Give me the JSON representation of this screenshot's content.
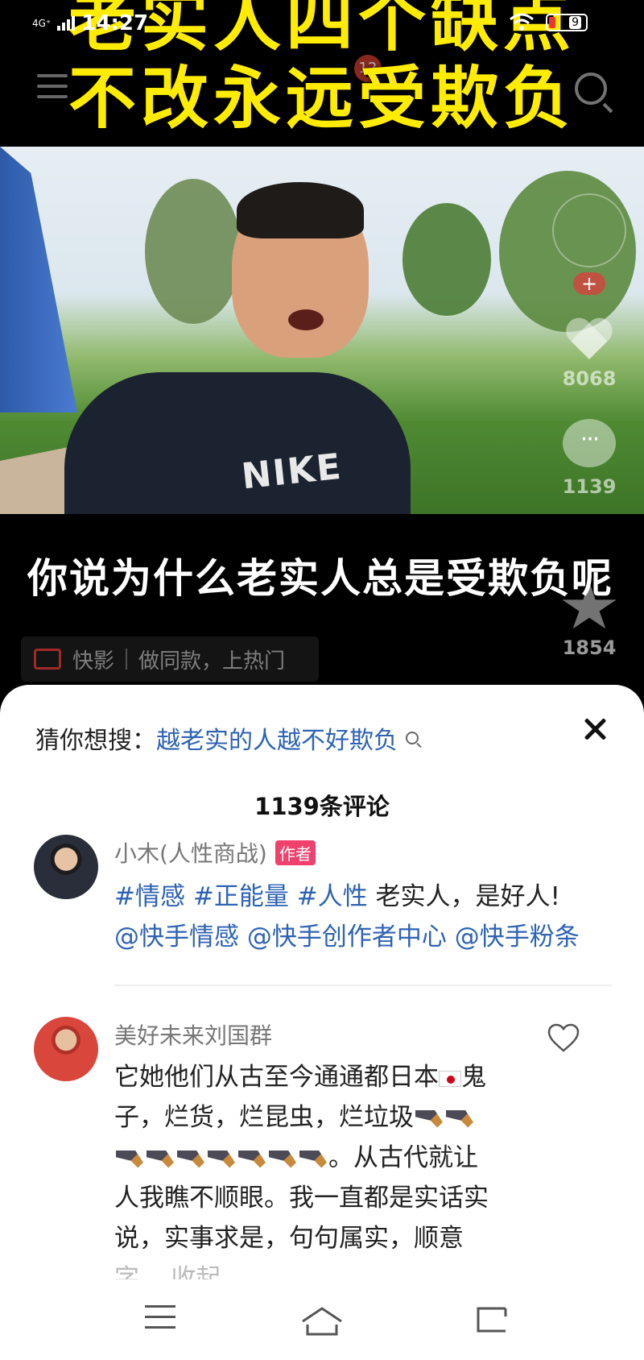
{
  "status_bar": {
    "network": "4G⁺",
    "time": "14:27",
    "battery": "9"
  },
  "top_nav": {
    "badge": "12"
  },
  "headline": {
    "line1": "老实人四个缺点",
    "line2": "不改永远受欺负"
  },
  "video": {
    "shirt_print": "NIKE",
    "subtitle": "你说为什么老实人总是受欺负呢"
  },
  "side_actions": {
    "likes": "8068",
    "comments": "1139",
    "favorites": "1854"
  },
  "kuaiying": {
    "brand": "快影",
    "cta": "做同款，上热门"
  },
  "sheet": {
    "suggest_label": "猜你想搜：",
    "suggest_query": "越老实的人越不好欺负",
    "comment_count": "1139条评论",
    "comments": [
      {
        "name": "小木(人性商战)",
        "badge": "作者",
        "tags": [
          "#情感",
          "#正能量",
          "#人性"
        ],
        "text": "老实人，是好人!",
        "mentions": "@快手情感 @快手创作者中心 @快手粉条"
      },
      {
        "name": "美好未来刘国群",
        "line1_a": "它她他们从古至今通通都日本",
        "line1_b": "鬼",
        "line2": "子，烂货，烂昆虫，烂垃圾",
        "line3": "。从古代就让",
        "line4": "人我瞧不顺眼。我一直都是实话实",
        "line5": "说，实事求是，句句属实，顺意",
        "line6": "字... 收起"
      }
    ]
  },
  "icons": {
    "menu": "menu-icon",
    "search": "search-icon",
    "heart": "heart-icon",
    "comment": "comment-icon",
    "star": "star-icon",
    "close": "close-icon",
    "like": "like-icon",
    "home": "home-icon",
    "back": "back-icon"
  },
  "colors": {
    "headline": "#ffec00",
    "link": "#2e62b4",
    "author_badge": "#f0416e"
  }
}
